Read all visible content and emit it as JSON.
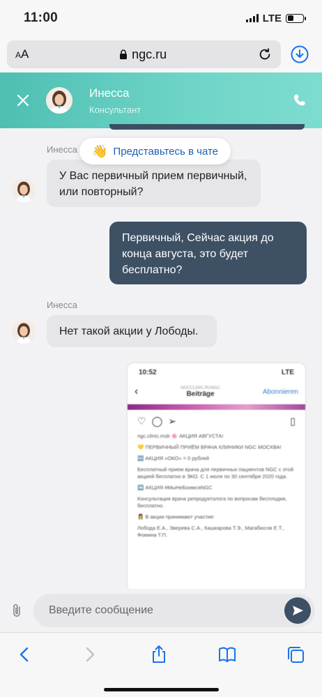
{
  "status": {
    "time": "11:00",
    "network": "LTE"
  },
  "browser": {
    "aa_label": "AA",
    "url": "ngc.ru"
  },
  "chat_header": {
    "name": "Инесса",
    "role": "Консультант"
  },
  "toast": {
    "text": "Представьтесь в чате",
    "icon": "waving-hand-icon"
  },
  "messages": [
    {
      "sender": "Инесса",
      "text": "У Вас первичный прием первичный, или повторный?",
      "direction": "in"
    },
    {
      "text": "Первичный, Сейчас акция до конца августа, это будет бесплатно?",
      "direction": "out"
    },
    {
      "sender": "Инесса",
      "text": "Нет такой акции у Лободы.",
      "direction": "in"
    }
  ],
  "attachment": {
    "status_time": "10:52",
    "status_right": "LTE",
    "nav_sub": "NGCCLINIC.RUNGC",
    "nav_title": "Beiträge",
    "nav_follow": "Abonnieren",
    "lines": [
      "ngc.clinic.msk 🌸 АКЦИЯ АВГУСТА!",
      "💛 ПЕРВИЧНЫЙ ПРИЁМ ВРАЧА КЛИНИКИ NGC МОСКВА!",
      "🆓 АКЦИЯ «ОКО» = 0 рублей",
      "Бесплатный прием врача для первичных пациентов NGC с этой акцией бесплатно в ЭКО. С 1 июля по 30 сентября 2020 года.",
      "➡️ АКЦИЯ #МыНеБоимсяNGC",
      "Консультация врача репродуктолога по вопросам бесплодия, бесплатно.",
      "👩‍⚕️ В акции принимают участие:",
      "Лобода Е.А., Зверева С.А., Кашкарова Т.Э., Магабюсов Е.Т., Фомина Т.П."
    ]
  },
  "composer": {
    "placeholder": "Введите сообщение"
  },
  "colors": {
    "accent": "#4ebfb2",
    "outgoing_bubble": "#3d5064",
    "toast_text": "#1e5fb0",
    "safari_blue": "#1a73e8"
  }
}
